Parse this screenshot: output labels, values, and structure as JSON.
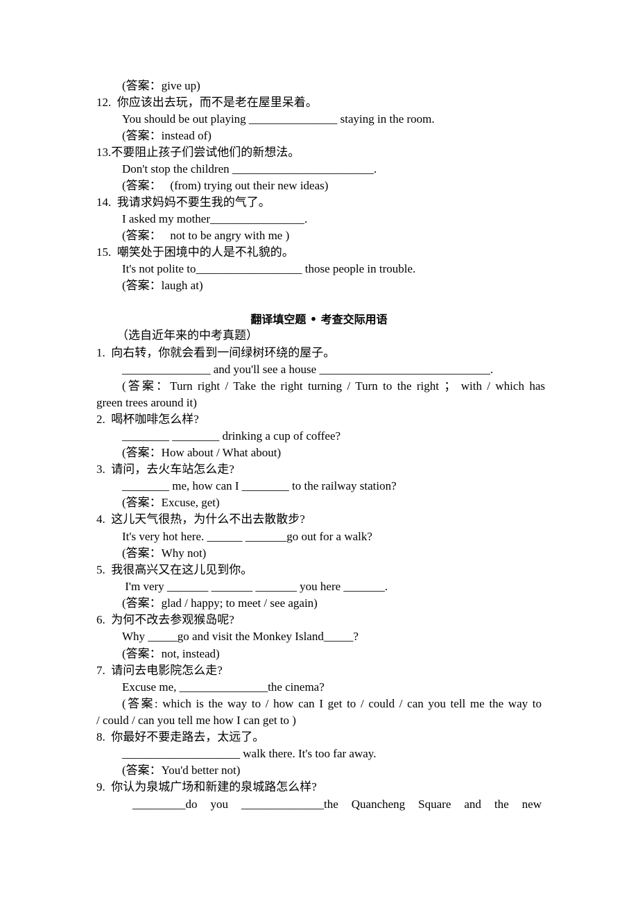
{
  "document": {
    "lines_part1": [
      "(答案：give up)",
      "12.  你应该出去玩，而不是老在屋里呆着。",
      "You should be out playing _______________ staying in the room.",
      "(答案：instead of)",
      "13.不要阻止孩子们尝试他们的新想法。",
      "Don't stop the children ________________________.",
      "(答案：   (from) trying out their new ideas)",
      "14.  我请求妈妈不要生我的气了。",
      "I asked my mother________________.",
      "(答案：   not to be angry with me )",
      "15.  嘲笑处于困境中的人是不礼貌的。",
      "It's not polite to__________________ those people in trouble.",
      "(答案：laugh at)"
    ],
    "section_title": "翻译填空题 • 考查交际用语",
    "section_subtitle": "（选自近年来的中考真题）",
    "items": [
      {
        "prompt": "1.  向右转，你就会看到一间绿树环绕的屋子。",
        "sentence": "_______________ and you'll see a house _____________________________.",
        "answer_line1": "(答案：Turn right / Take the right turning / Turn to the right  ；   with / which has",
        "answer_line2": "green trees around it)"
      },
      {
        "prompt": "2.  喝杯咖啡怎么样?",
        "sentence": "________ ________ drinking a cup of coffee?",
        "answer_line1": "(答案：How about / What about)"
      },
      {
        "prompt": "3.  请问，去火车站怎么走?",
        "sentence": "________ me, how can I ________ to the railway station?",
        "answer_line1": "(答案：Excuse, get)"
      },
      {
        "prompt": "4.  这儿天气很热，为什么不出去散散步?",
        "sentence": "It's very hot here. ______ _______go out for a walk?",
        "answer_line1": "(答案：Why not)"
      },
      {
        "prompt": "5.  我很高兴又在这儿见到你。",
        "sentence": " I'm very _______ _______ _______ you here _______.",
        "answer_line1": "(答案：glad / happy; to meet / see again)"
      },
      {
        "prompt": "6.  为何不改去参观猴岛呢?",
        "sentence": "Why _____go and visit the Monkey Island_____?",
        "answer_line1": "(答案：not, instead)"
      },
      {
        "prompt": "7.  请问去电影院怎么走?",
        "sentence": "Excuse me, _______________the cinema?",
        "answer_line1": "(答案: which is the way to / how can I get to / could / can you tell me the way to",
        "answer_line2": "/ could / can you tell me how I can get to )"
      },
      {
        "prompt": "8.  你最好不要走路去，太远了。",
        "sentence": "____________________ walk there. It's too far away.",
        "answer_line1": "(答案：You'd better not)"
      },
      {
        "prompt": "9.  你认为泉城广场和新建的泉城路怎么样?",
        "sentence": "_________do  you  ______________the  Quancheng  Square  and  the  new"
      }
    ]
  }
}
